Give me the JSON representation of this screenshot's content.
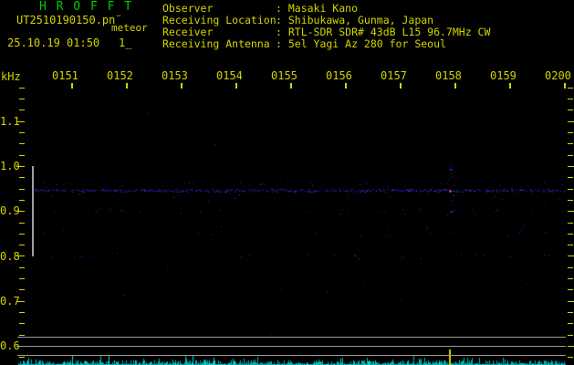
{
  "header": {
    "app_title": "H R O F F T",
    "filename": "UT2510190150.pn¨",
    "mode_label": "meteor",
    "date_time": "25.10.19 01:50",
    "counter": "1_",
    "fields": [
      {
        "label": "Observer",
        "value": ": Masaki Kano"
      },
      {
        "label": "Receiving Location",
        "value": ": Shibukawa, Gunma, Japan"
      },
      {
        "label": "Receiver",
        "value": ": RTL-SDR SDR# 43dB L15 96.7MHz CW"
      },
      {
        "label": "Receiving Antenna",
        "value": ": 5el Yagi Az 280 for Seoul"
      }
    ]
  },
  "chart_data": {
    "type": "heatmap",
    "title": "",
    "x_axis": {
      "start_time": "0150",
      "end_time": "0200",
      "tick_labels": [
        "0151",
        "0152",
        "0153",
        "0154",
        "0155",
        "0156",
        "0157",
        "0158",
        "0159",
        "0200"
      ],
      "minutes_per_division": 1
    },
    "y_axis": {
      "unit_label": "kHz",
      "tick_labels": [
        "1.1",
        "1.0",
        "0.9",
        "0.8",
        "0.7",
        "0.6"
      ],
      "minor_step_khz": 0.025,
      "range_khz": [
        0.575,
        1.175
      ]
    },
    "count_band_marker_khz": [
      0.8,
      1.0
    ],
    "noise_bands": [
      {
        "freq_khz": 0.962,
        "halfwidth_khz": 0.006,
        "density": 0.13,
        "bright": false
      },
      {
        "freq_khz": 0.946,
        "halfwidth_khz": 0.003,
        "density": 0.55,
        "bright": true
      },
      {
        "freq_khz": 0.93,
        "halfwidth_khz": 0.009,
        "density": 0.1,
        "bright": false
      },
      {
        "freq_khz": 0.9,
        "halfwidth_khz": 0.006,
        "density": 0.15,
        "bright": false
      },
      {
        "freq_khz": 0.855,
        "halfwidth_khz": 0.013,
        "density": 0.09,
        "bright": false
      },
      {
        "freq_khz": 0.8,
        "halfwidth_khz": 0.007,
        "density": 0.09,
        "bright": false
      },
      {
        "freq_khz": 0.72,
        "halfwidth_khz": 0.02,
        "density": 0.035,
        "bright": false
      },
      {
        "freq_khz": 0.85,
        "halfwidth_khz": 0.23,
        "density": 0.022,
        "bright": false
      },
      {
        "freq_khz": 1.08,
        "halfwidth_khz": 0.09,
        "density": 0.004,
        "bright": false
      }
    ],
    "echo_events": [
      {
        "minutes_after_start": 7.9,
        "freq_khz": 0.946,
        "peak": "red",
        "meter_spike": true
      }
    ],
    "level_meter": {
      "reference_lines": 3,
      "trace_name": "noise-level"
    }
  },
  "colors": {
    "background": "#000000",
    "title_green": "#00cc00",
    "text_yellow": "#d4d400",
    "grid_gray": "#9a9a9a",
    "trace_cyan": "#00b4b4",
    "noise_blue": "#2020b0",
    "echo_red": "#cc1111"
  }
}
